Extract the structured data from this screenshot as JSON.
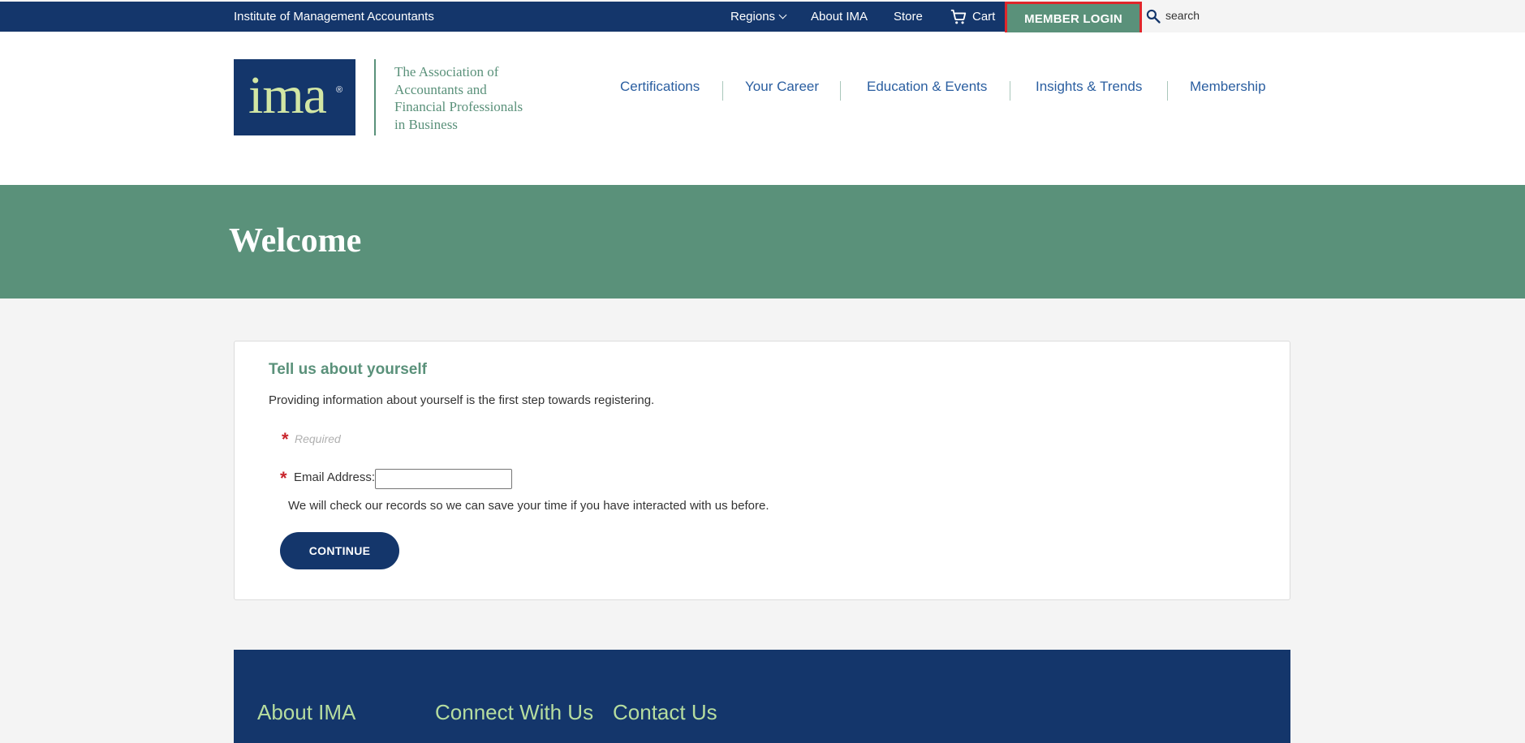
{
  "topbar": {
    "org_name": "Institute of Management Accountants",
    "regions_label": "Regions",
    "about_label": "About IMA",
    "store_label": "Store",
    "cart_label": "Cart",
    "member_login_label": "MEMBER LOGIN",
    "search_placeholder": "search"
  },
  "header": {
    "logo_text": "ima",
    "logo_reg": "®",
    "tagline": [
      "The Association of",
      "Accountants and",
      "Financial Professionals",
      "in Business"
    ],
    "nav": [
      "Certifications",
      "Your Career",
      "Education & Events",
      "Insights & Trends",
      "Membership"
    ]
  },
  "hero": {
    "title": "Welcome"
  },
  "form": {
    "title": "Tell us about yourself",
    "description": "Providing information about yourself is the first step towards registering.",
    "required_star": "*",
    "required_note": "Required",
    "email_label": "Email Address:",
    "email_value": "",
    "check_note": "We will check our records so we can save your time if you have interacted with us before.",
    "continue_label": "CONTINUE"
  },
  "footer": {
    "headings": [
      "About IMA",
      "Connect With Us",
      "Contact Us"
    ]
  },
  "colors": {
    "navy": "#14366b",
    "green": "#5a917a",
    "light_green": "#b6dd9f",
    "link_blue": "#2a5ea0",
    "required_red": "#c8242b",
    "highlight_red": "#e0262b"
  },
  "icons": [
    "chevron-down-icon",
    "cart-icon",
    "search-icon"
  ]
}
